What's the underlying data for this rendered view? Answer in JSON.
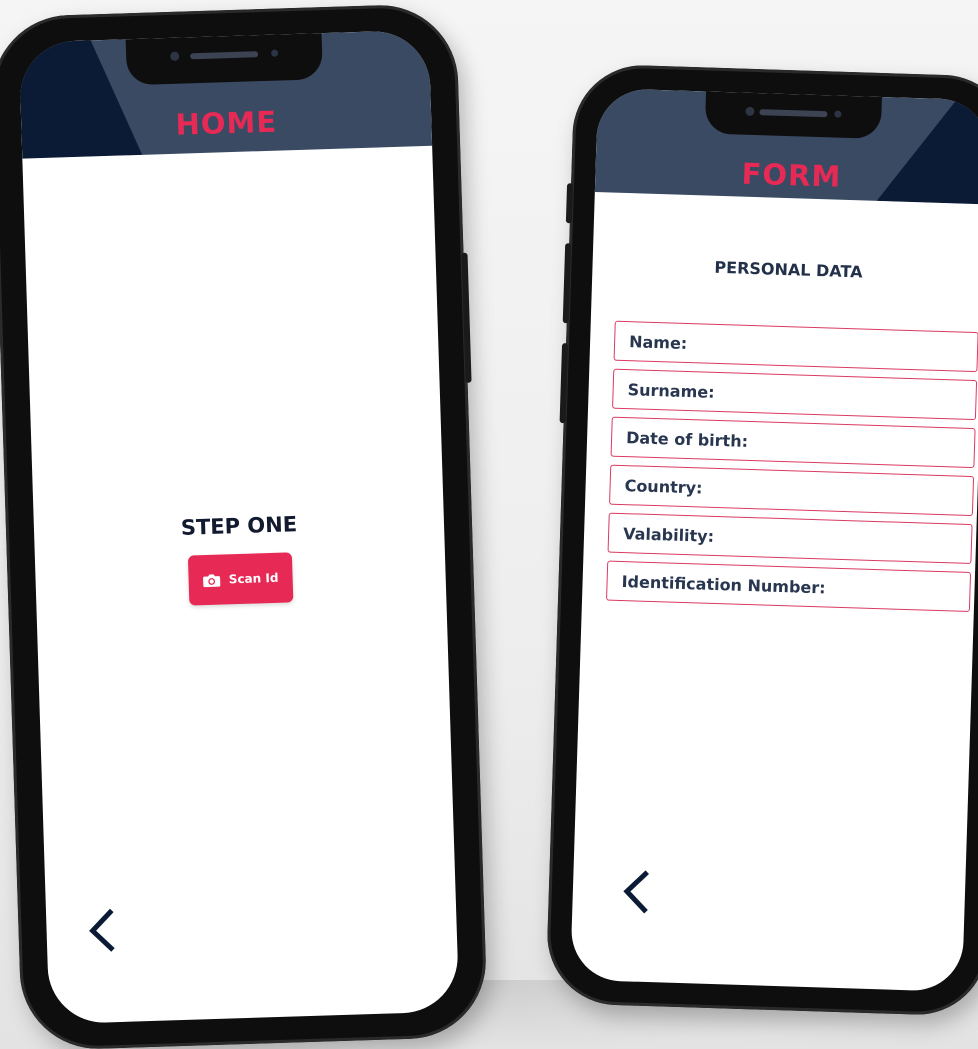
{
  "home_screen": {
    "header_title": "HOME",
    "step_title": "STEP ONE",
    "scan_button_label": "Scan Id",
    "scan_button_icon": "camera-icon",
    "back_icon": "chevron-left-icon"
  },
  "form_screen": {
    "header_title": "FORM",
    "section_title": "PERSONAL DATA",
    "fields": [
      {
        "label": "Name:"
      },
      {
        "label": "Surname:"
      },
      {
        "label": "Date of birth:"
      },
      {
        "label": "Country:"
      },
      {
        "label": "Valability:"
      },
      {
        "label": "Identification Number:"
      }
    ],
    "back_icon": "chevron-left-icon"
  },
  "colors": {
    "accent": "#e62a55",
    "header": "#394a62",
    "header_dark": "#0c1b35",
    "text_dark": "#111a2e"
  }
}
